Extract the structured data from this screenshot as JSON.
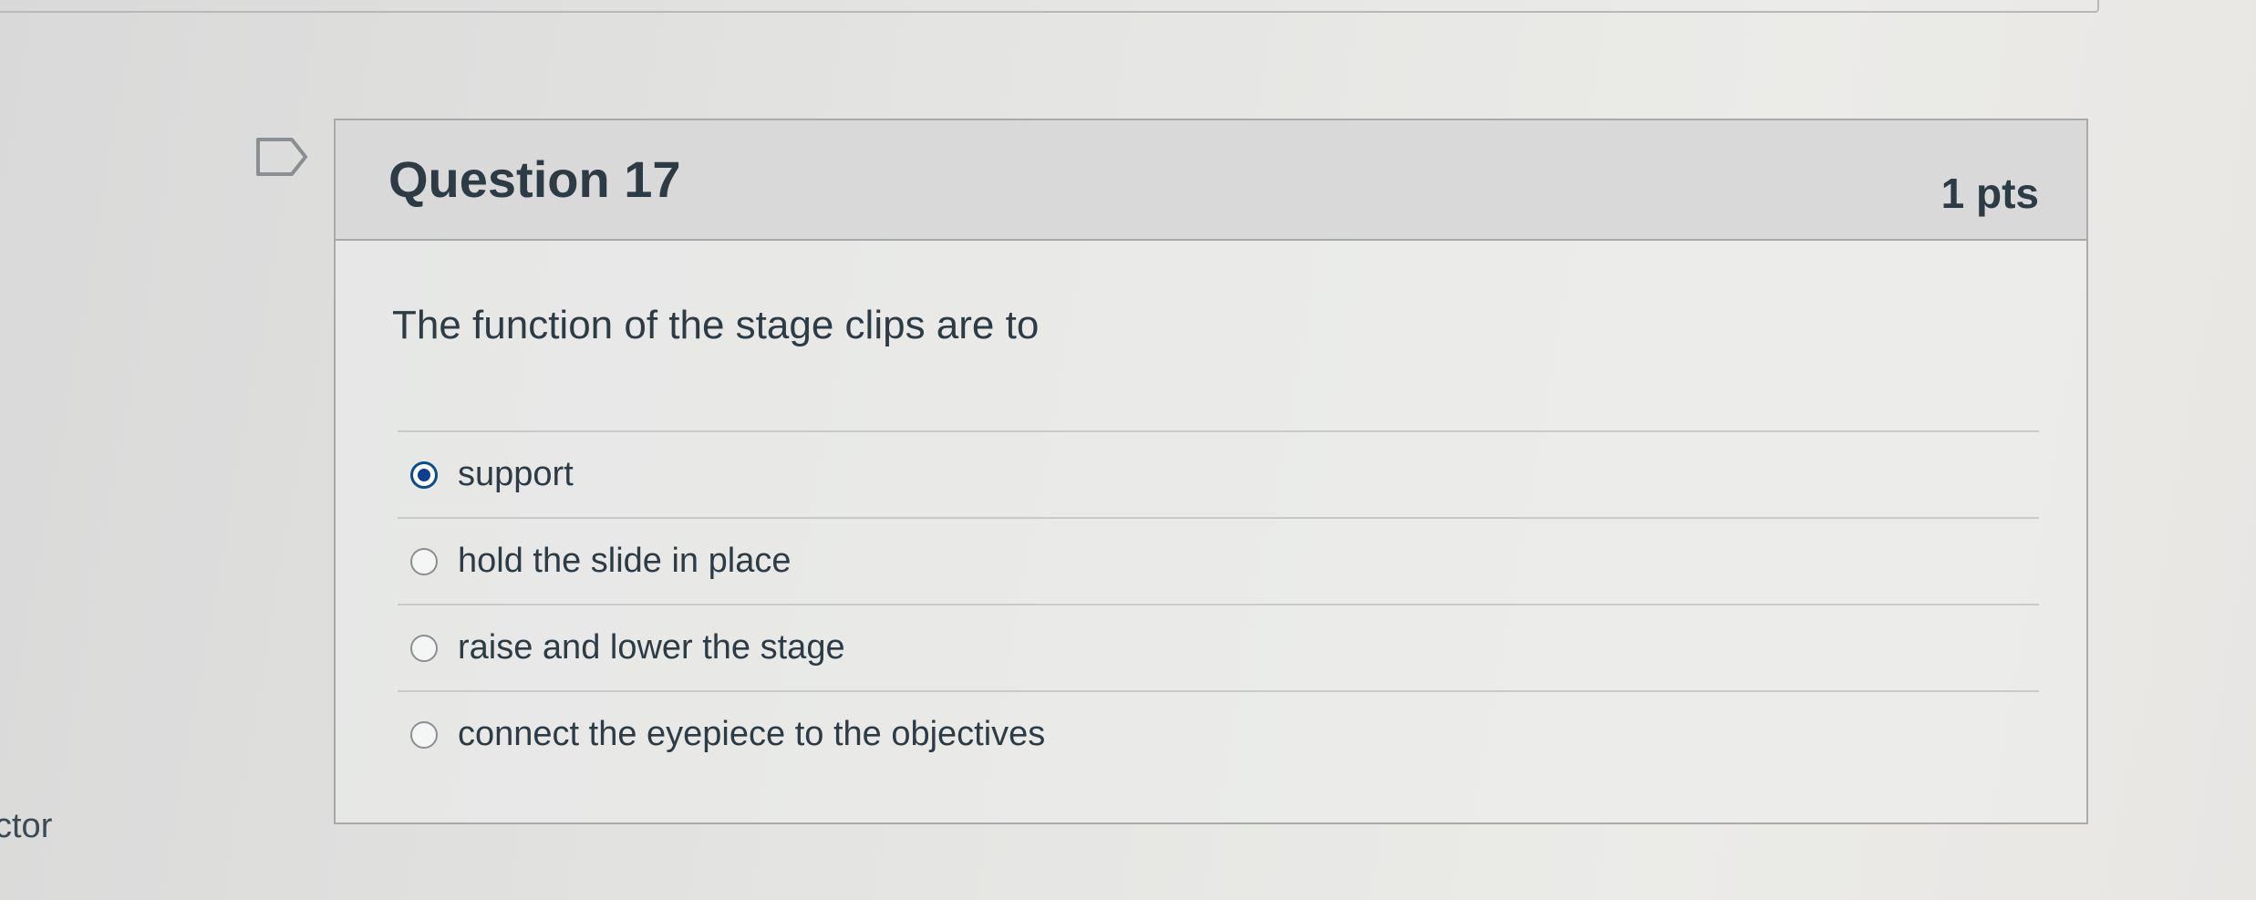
{
  "question": {
    "title": "Question 17",
    "points": "1 pts",
    "text": "The function of the stage clips are to",
    "answers": [
      {
        "label": "support",
        "selected": true
      },
      {
        "label": "hold the slide in place",
        "selected": false
      },
      {
        "label": "raise and lower the stage",
        "selected": false
      },
      {
        "label": "connect the eyepiece to the objectives",
        "selected": false
      }
    ]
  },
  "side_label": "ctor",
  "icons": {
    "flag": "flag-question-icon"
  },
  "colors": {
    "accent": "#0b3f8f",
    "text": "#2d3b45",
    "header_bg": "#d8d9d8",
    "border": "#a9a9a9"
  }
}
